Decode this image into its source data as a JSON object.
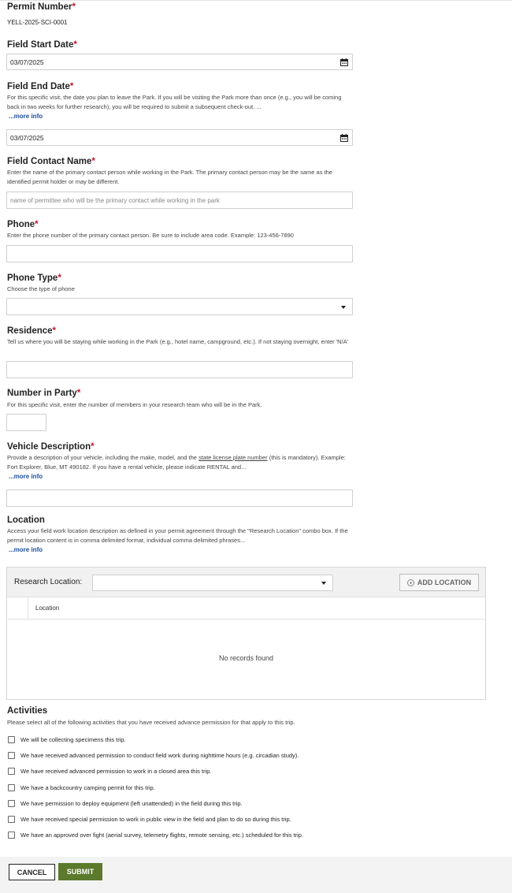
{
  "permit_number": {
    "label": "Permit Number",
    "value": "YELL-2025-SCI-0001"
  },
  "field_start_date": {
    "label": "Field Start Date",
    "value": "03/07/2025"
  },
  "field_end_date": {
    "label": "Field End Date",
    "help": "For this specific visit, the date you plan to leave the Park. If you will be visiting the Park more than once (e.g., you will be coming back in two weeks for further research), you will be required to submit a subsequent check-out. ...",
    "more": "...more info",
    "value": "03/07/2025"
  },
  "field_contact_name": {
    "label": "Field Contact Name",
    "help": "Enter the name of the primary contact person while working in the Park. The primary contact person may be the same as the identified permit holder or may be different.",
    "placeholder": "name of permittee who will be the primary contact while working in the park"
  },
  "phone": {
    "label": "Phone",
    "help": "Enter the phone number of the primary contact person. Be sure to include area code. Example: 123-456-7890"
  },
  "phone_type": {
    "label": "Phone Type",
    "help": "Choose the type of phone"
  },
  "residence": {
    "label": "Residence",
    "help": "Tell us where you will be staying while working in the Park (e.g., hotel name, campground, etc.). If not staying overnight, enter 'N/A'"
  },
  "number_in_party": {
    "label": "Number in Party",
    "help": "For this specific visit, enter the number of members in your research team who will be in the Park."
  },
  "vehicle_description": {
    "label": "Vehicle Description",
    "help_1": "Provide a description of your vehicle, including the make, model, and the ",
    "help_link": "state license plate number",
    "help_2": " (this is mandatory). Example: Fort Explorer, Blue, MT 490182. If you have a rental vehicle, please indicate RENTAL and...",
    "more": "...more info"
  },
  "location": {
    "label": "Location",
    "help": "Access your field work location description as defined in your permit agreement through the \"Research Location\" combo box. If the permit location content is in comma delimited format, individual comma delimited phrases...",
    "more": "...more info",
    "research_location_label": "Research Location:",
    "add_button": "ADD LOCATION",
    "column_header": "Location",
    "empty_message": "No records found"
  },
  "activities": {
    "label": "Activities",
    "help": "Please select all of the following activities that you have received advance permission for that apply to this trip.",
    "items": [
      "We will be collecting specimens this trip.",
      "We have received advanced permission to conduct field work during nighttime hours (e.g. circadian study).",
      "We have received advanced permission to work in a closed area this trip.",
      "We have a backcountry camping permit for this trip.",
      "We have permission to deploy equipment (left unattended) in the field during this trip.",
      "We have received special permission to work in public view in the field and plan to do so during this trip.",
      "We have an approved over fight (aerial survey, telemetry flights, remote sensing, etc.) scheduled for this trip."
    ]
  },
  "footer": {
    "cancel": "CANCEL",
    "submit": "SUBMIT"
  },
  "required_marker": "*",
  "colors": {
    "required": "#c4122f",
    "link": "#1a4f9c",
    "submit": "#5b7a2c"
  },
  "icons": {
    "date": "calendar-icon",
    "dropdown": "chevron-down-icon",
    "add": "plus-circle-icon"
  }
}
